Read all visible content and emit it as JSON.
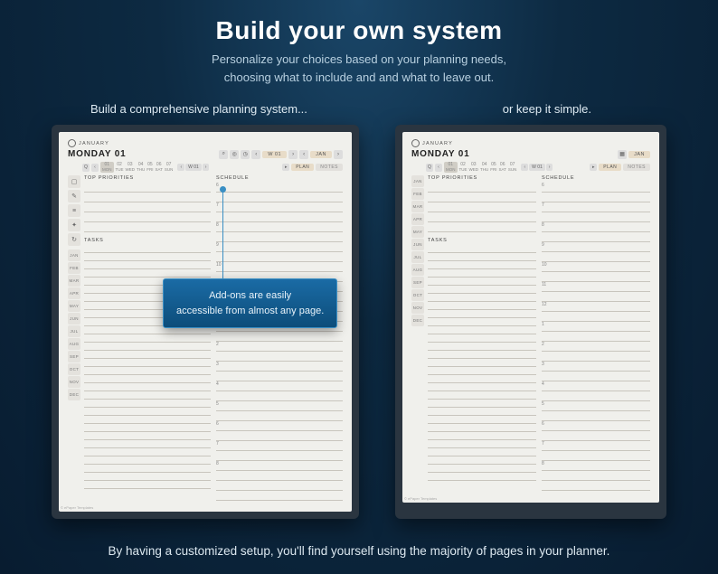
{
  "header": {
    "title": "Build your own system",
    "subtitle_line1": "Personalize your choices based on your planning needs,",
    "subtitle_line2": "choosing what to include and and what to leave out."
  },
  "captions": {
    "left": "Build a comprehensive planning system...",
    "right": "or keep it simple."
  },
  "planner": {
    "month": "JANUARY",
    "date": "MONDAY 01",
    "week_label": "W 01",
    "jan_pill": "JAN",
    "tabs": {
      "plan": "PLAN",
      "notes": "NOTES"
    },
    "days": [
      {
        "n": "01",
        "d": "MON"
      },
      {
        "n": "02",
        "d": "TUE"
      },
      {
        "n": "03",
        "d": "WED"
      },
      {
        "n": "04",
        "d": "THU"
      },
      {
        "n": "05",
        "d": "FRI"
      },
      {
        "n": "06",
        "d": "SAT"
      },
      {
        "n": "07",
        "d": "SUN"
      }
    ],
    "sections": {
      "priorities": "TOP PRIORITIES",
      "schedule": "SCHEDULE",
      "tasks": "TASKS"
    },
    "hours": [
      "6",
      "7",
      "8",
      "9",
      "10",
      "11",
      "12",
      "1",
      "2",
      "3",
      "4",
      "5",
      "6",
      "7",
      "8"
    ],
    "months": [
      "JAN",
      "FEB",
      "MAR",
      "APR",
      "MAY",
      "JUN",
      "JUL",
      "AUG",
      "SEP",
      "OCT",
      "NOV",
      "DEC"
    ],
    "nav_prefix": "Q",
    "footer_credit": "© ePaper Templates"
  },
  "callout": {
    "line1": "Add-ons are easily",
    "line2": "accessible from almost any page."
  },
  "footer": "By having a customized setup, you'll find yourself using the majority of pages in your planner."
}
